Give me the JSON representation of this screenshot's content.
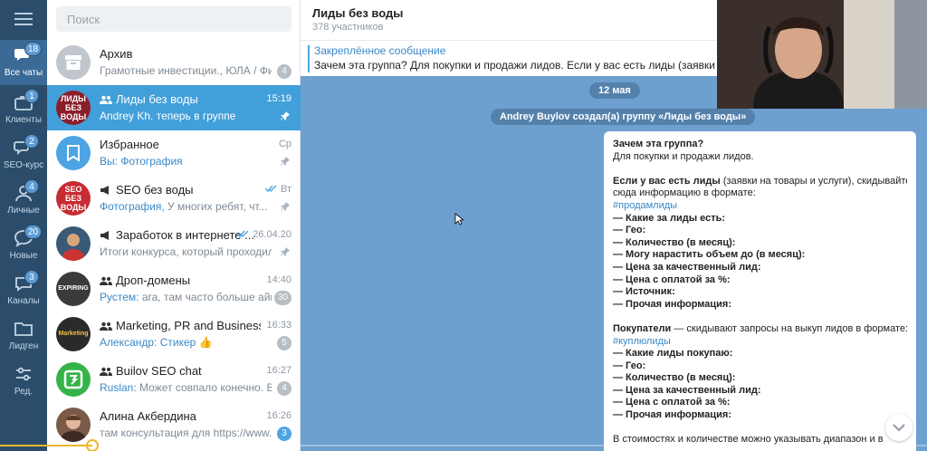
{
  "rail": {
    "items": [
      {
        "label": "Все чаты",
        "badge": "18"
      },
      {
        "label": "Клиенты",
        "badge": "1"
      },
      {
        "label": "SEO-курс",
        "badge": "2"
      },
      {
        "label": "Личные",
        "badge": "4"
      },
      {
        "label": "Новые",
        "badge": "20"
      },
      {
        "label": "Каналы",
        "badge": "3"
      },
      {
        "label": "Лидген",
        "badge": ""
      },
      {
        "label": "Ред.",
        "badge": ""
      }
    ]
  },
  "search": {
    "placeholder": "Поиск"
  },
  "chats": [
    {
      "title": "Архив",
      "time": "",
      "who": "",
      "preview": "Грамотные инвестиции., ЮЛА / Фиш...",
      "badge": "4",
      "avatar_text": "",
      "avatar_color": "#c0c6cc"
    },
    {
      "title": "Лиды без воды",
      "time": "15:19",
      "who": "",
      "preview": "Andrey Kh. теперь в группе",
      "badge": "",
      "avatar_text": "ЛИДЫ БЕЗ ВОДЫ",
      "avatar_color": "#8a1f2b"
    },
    {
      "title": "Избранное",
      "time": "Ср",
      "who": "Вы:",
      "preview": " Фотография",
      "badge": "",
      "avatar_text": "",
      "avatar_color": "#4ea4e2"
    },
    {
      "title": "SEO без воды",
      "time": "Вт",
      "who": "Фотография,",
      "preview": " У многих ребят, чт...",
      "badge": "",
      "avatar_text": "SEO БЕЗ ВОДЫ",
      "avatar_color": "#c82b32"
    },
    {
      "title": "Заработок в интернете ...",
      "time": "26.04.20",
      "who": "",
      "preview": "Итоги конкурса, который проходил в...",
      "badge": "",
      "avatar_text": "",
      "avatar_color": "#3a5a78"
    },
    {
      "title": "Дроп-домены",
      "time": "14:40",
      "who": "Рустем:",
      "preview": " ага, там часто больше айпи...",
      "badge": "30",
      "avatar_text": "EXPIRING",
      "avatar_color": "#3b3b3b"
    },
    {
      "title": "Marketing, PR and Business Ad...",
      "time": "16:33",
      "who": "Александр:",
      "preview": " Стикер 👍",
      "badge": "5",
      "avatar_text": "Marketing",
      "avatar_color": "#2a2a2a"
    },
    {
      "title": "Builov SEO chat",
      "time": "16:27",
      "who": "Ruslan:",
      "preview": " Может совпало конечно. В ин...",
      "badge": "4",
      "avatar_text": "",
      "avatar_color": "#35b34a"
    },
    {
      "title": "Алина Акбердина",
      "time": "16:26",
      "who": "",
      "preview": "там консультация для https://www.str...",
      "badge": "3",
      "avatar_text": "",
      "avatar_color": "#7b5a4a"
    }
  ],
  "header": {
    "title": "Лиды без воды",
    "subtitle": "378 участников"
  },
  "pinned": {
    "title": "Закреплённое сообщение",
    "text": "Зачем эта группа? Для покупки и продажи лидов.  Если у вас есть лиды (заявки на товар"
  },
  "service": {
    "date": "12 мая",
    "created": "Andrey Buylov создал(а) группу «Лиды без воды»"
  },
  "message": {
    "l1": "Зачем эта группа?",
    "l2": "Для покупки и продажи лидов.",
    "l3b": "Если у вас есть лиды",
    "l3": " (заявки на товары и услуги), скидывайте",
    "l4": "сюда информацию в формате:",
    "tag1": "#продамлиды",
    "f1": "— Какие за лиды есть:",
    "f2": "— Гео:",
    "f3": "— Количество (в месяц):",
    "f4": "— Могу нарастить объем до (в месяц):",
    "f5": "— Цена за качественный лид:",
    "f6": "— Цена с оплатой за %:",
    "f7": "— Источник:",
    "f8": "— Прочая информация:",
    "b1b": "Покупатели",
    "b1": " — скидывают запросы на выкуп лидов в формате:",
    "tag2": "#куплюлиды",
    "g1": "— Какие лиды покупаю:",
    "g2": "— Гео:",
    "g3": "— Количество (в месяц):",
    "g4": "— Цена за качественный лид:",
    "g5": "— Цена с оплатой за %:",
    "g6": "— Прочая информация:",
    "last": "В стоимостях и количестве можно указывать диапазон и в"
  },
  "video": {
    "progress": 0.1
  }
}
